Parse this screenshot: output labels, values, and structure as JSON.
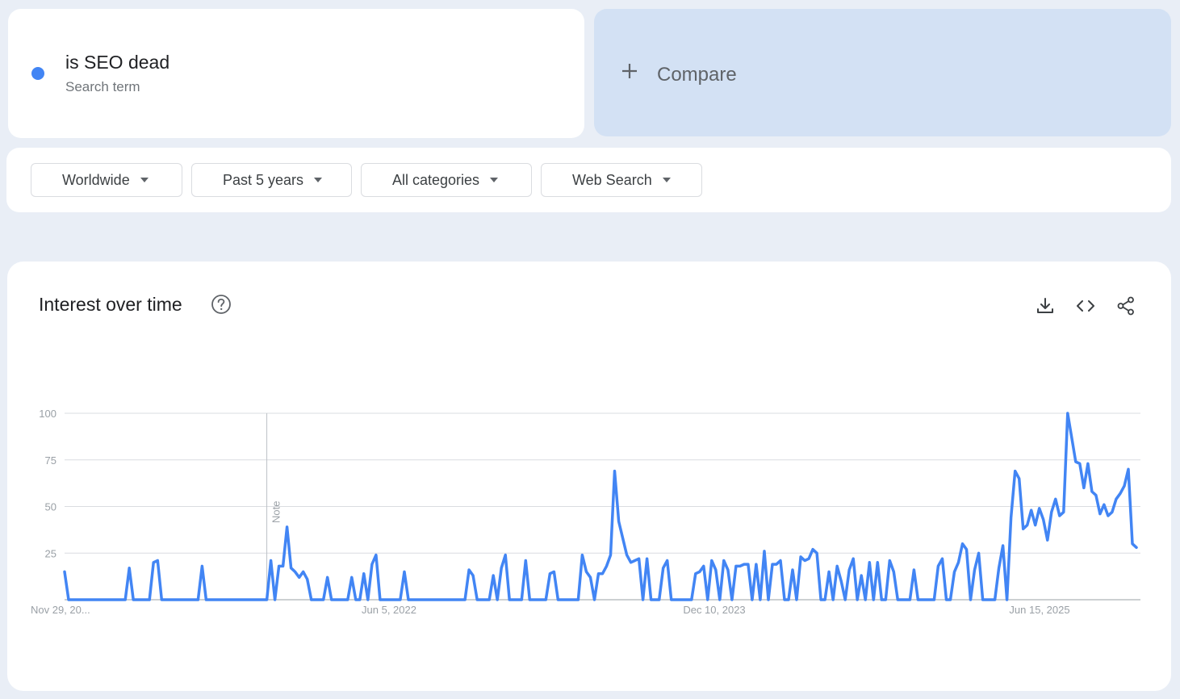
{
  "search_term": {
    "title": "is SEO dead",
    "subtitle": "Search term",
    "color": "#4285f4"
  },
  "compare": {
    "label": "Compare"
  },
  "filters": {
    "location": "Worldwide",
    "time_range": "Past 5 years",
    "category": "All categories",
    "property": "Web Search"
  },
  "panel": {
    "title": "Interest over time",
    "icons": [
      "help-icon",
      "download-icon",
      "embed-icon",
      "share-icon"
    ]
  },
  "note_label": "Note",
  "chart_data": {
    "type": "line",
    "title": "Interest over time",
    "xlabel": "",
    "ylabel": "",
    "ylim": [
      0,
      100
    ],
    "yticks": [
      "100",
      "75",
      "50",
      "25"
    ],
    "xtick_labels": [
      "Nov 29, 20...",
      "Jun 5, 2022",
      "Dec 10, 2023",
      "Jun 15, 2025"
    ],
    "grid": true,
    "note_week_index": 50,
    "series": [
      {
        "color": "#4285f4",
        "values": [
          15,
          0,
          0,
          0,
          0,
          0,
          0,
          0,
          0,
          0,
          0,
          0,
          0,
          0,
          0,
          0,
          17,
          0,
          0,
          0,
          0,
          0,
          20,
          21,
          0,
          0,
          0,
          0,
          0,
          0,
          0,
          0,
          0,
          0,
          18,
          0,
          0,
          0,
          0,
          0,
          0,
          0,
          0,
          0,
          0,
          0,
          0,
          0,
          0,
          0,
          0,
          21,
          0,
          18,
          18,
          39,
          17,
          15,
          12,
          15,
          11,
          0,
          0,
          0,
          0,
          12,
          0,
          0,
          0,
          0,
          0,
          12,
          0,
          0,
          14,
          0,
          19,
          24,
          0,
          0,
          0,
          0,
          0,
          0,
          15,
          0,
          0,
          0,
          0,
          0,
          0,
          0,
          0,
          0,
          0,
          0,
          0,
          0,
          0,
          0,
          16,
          13,
          0,
          0,
          0,
          0,
          13,
          0,
          17,
          24,
          0,
          0,
          0,
          0,
          21,
          0,
          0,
          0,
          0,
          0,
          14,
          15,
          0,
          0,
          0,
          0,
          0,
          0,
          24,
          15,
          12,
          0,
          14,
          14,
          18,
          24,
          69,
          42,
          33,
          24,
          20,
          21,
          22,
          0,
          22,
          0,
          0,
          0,
          17,
          21,
          0,
          0,
          0,
          0,
          0,
          0,
          14,
          15,
          18,
          0,
          21,
          16,
          0,
          21,
          16,
          0,
          18,
          18,
          19,
          19,
          0,
          19,
          0,
          26,
          0,
          19,
          19,
          21,
          0,
          0,
          16,
          0,
          23,
          21,
          22,
          27,
          25,
          0,
          0,
          15,
          0,
          18,
          10,
          0,
          16,
          22,
          0,
          13,
          0,
          20,
          0,
          20,
          0,
          0,
          21,
          15,
          0,
          0,
          0,
          0,
          16,
          0,
          0,
          0,
          0,
          0,
          18,
          22,
          0,
          0,
          15,
          20,
          30,
          27,
          0,
          16,
          25,
          0,
          0,
          0,
          0,
          17,
          29,
          0,
          44,
          69,
          65,
          38,
          40,
          48,
          40,
          49,
          43,
          32,
          47,
          54,
          45,
          47,
          100,
          87,
          74,
          73,
          60,
          73,
          58,
          56,
          46,
          51,
          45,
          47,
          54,
          57,
          61,
          70,
          30,
          28
        ]
      }
    ]
  }
}
